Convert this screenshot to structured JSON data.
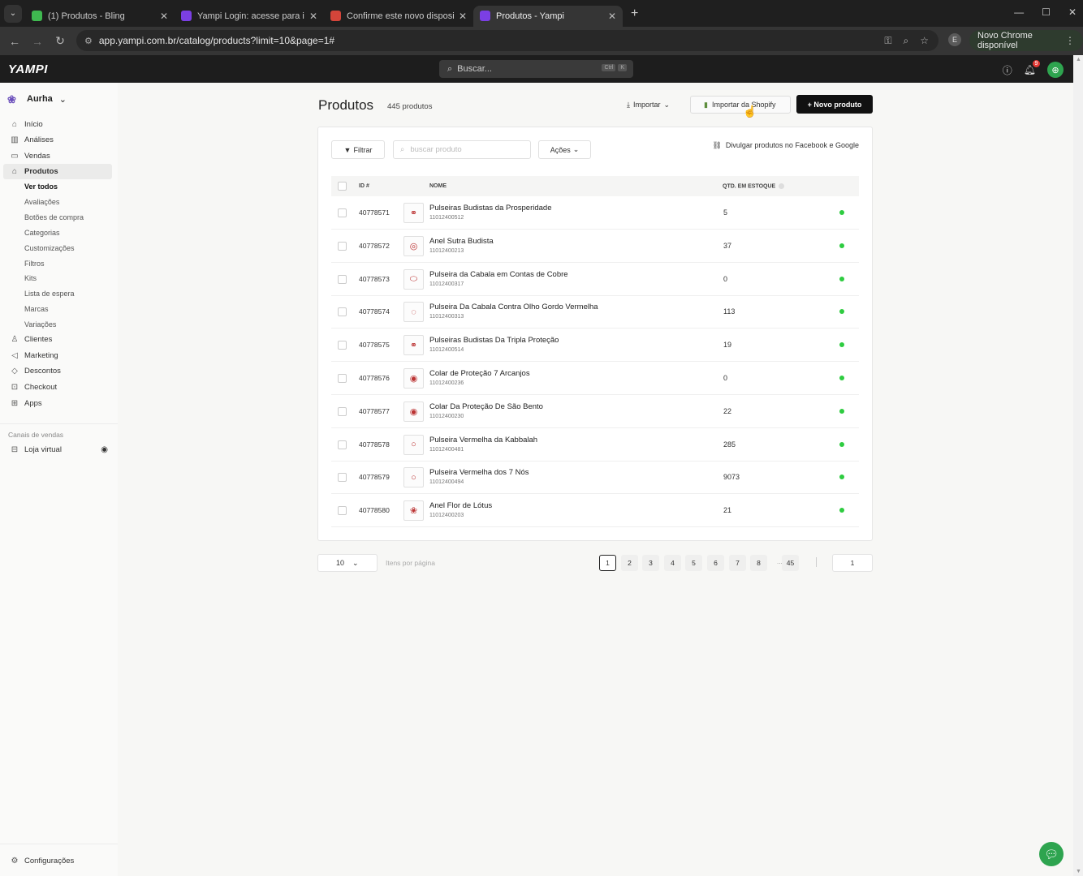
{
  "browser": {
    "tabs": [
      {
        "title": "(1) Produtos - Bling",
        "fav_color": "#3fb950",
        "fav_glyph": "B"
      },
      {
        "title": "Yampi Login: acesse para inicia",
        "fav_color": "#7b3fe4",
        "fav_glyph": "Y"
      },
      {
        "title": "Confirme este novo dispositivo",
        "fav_color": "#d4453a",
        "fav_glyph": "M"
      },
      {
        "title": "Produtos - Yampi",
        "fav_color": "#7b3fe4",
        "fav_glyph": "Y"
      }
    ],
    "url": "app.yampi.com.br/catalog/products?limit=10&page=1#",
    "profile_initial": "E",
    "update_label": "Novo Chrome disponível"
  },
  "app": {
    "logo": "YAMPI",
    "search_placeholder": "Buscar...",
    "kbd": [
      "Ctrl",
      "K"
    ],
    "notif_count": "9"
  },
  "sidebar": {
    "store_name": "Aurha",
    "items": [
      {
        "label": "Início",
        "icon": "home-icon"
      },
      {
        "label": "Análises",
        "icon": "chart-icon"
      },
      {
        "label": "Vendas",
        "icon": "inbox-icon"
      },
      {
        "label": "Produtos",
        "icon": "tag-icon"
      }
    ],
    "sub_items": [
      "Ver todos",
      "Avaliações",
      "Botões de compra",
      "Categorias",
      "Customizações",
      "Filtros",
      "Kits",
      "Lista de espera",
      "Marcas",
      "Variações"
    ],
    "items2": [
      {
        "label": "Clientes",
        "icon": "user-icon"
      },
      {
        "label": "Marketing",
        "icon": "megaphone-icon"
      },
      {
        "label": "Descontos",
        "icon": "discount-icon"
      },
      {
        "label": "Checkout",
        "icon": "cart-icon"
      },
      {
        "label": "Apps",
        "icon": "grid-icon"
      }
    ],
    "sales_channels_label": "Canais de vendas",
    "store_channel": "Loja virtual",
    "settings": "Configurações"
  },
  "main": {
    "title": "Produtos",
    "count": "445 produtos",
    "import_label": "Importar",
    "shopify_label": "Importar da Shopify",
    "new_label": "+ Novo produto",
    "filter_label": "Filtrar",
    "search_placeholder": "buscar produto",
    "actions_label": "Ações",
    "share_label": "Divulgar produtos no Facebook e Google",
    "columns": {
      "id": "ID #",
      "name": "NOME",
      "stock": "QTD. EM ESTOQUE"
    }
  },
  "products": [
    {
      "id": "40778571",
      "name": "Pulseiras Budistas da Prosperidade",
      "sku": "11012400512",
      "stock": "5",
      "thumb": "⚭"
    },
    {
      "id": "40778572",
      "name": "Anel Sutra Budista",
      "sku": "11012400213",
      "stock": "37",
      "thumb": "◎"
    },
    {
      "id": "40778573",
      "name": "Pulseira da Cabala em Contas de Cobre",
      "sku": "11012400317",
      "stock": "0",
      "thumb": "⬭"
    },
    {
      "id": "40778574",
      "name": "Pulseira Da Cabala Contra Olho Gordo Vermelha",
      "sku": "11012400313",
      "stock": "113",
      "thumb": "◌"
    },
    {
      "id": "40778575",
      "name": "Pulseiras Budistas Da Tripla Proteção",
      "sku": "11012400514",
      "stock": "19",
      "thumb": "⚭"
    },
    {
      "id": "40778576",
      "name": "Colar de Proteção 7 Arcanjos",
      "sku": "11012400236",
      "stock": "0",
      "thumb": "◉"
    },
    {
      "id": "40778577",
      "name": "Colar Da Proteção De São Bento",
      "sku": "11012400230",
      "stock": "22",
      "thumb": "◉"
    },
    {
      "id": "40778578",
      "name": "Pulseira Vermelha da Kabbalah",
      "sku": "11012400481",
      "stock": "285",
      "thumb": "○"
    },
    {
      "id": "40778579",
      "name": "Pulseira Vermelha dos 7 Nós",
      "sku": "11012400494",
      "stock": "9073",
      "thumb": "○"
    },
    {
      "id": "40778580",
      "name": "Anel Flor de Lótus",
      "sku": "11012400203",
      "stock": "21",
      "thumb": "❀"
    }
  ],
  "pagination": {
    "per_page": "10",
    "per_page_label": "Itens por página",
    "pages": [
      "1",
      "2",
      "3",
      "4",
      "5",
      "6",
      "7",
      "8"
    ],
    "dots": "...",
    "last": "45",
    "jump_value": "1"
  },
  "colors": {
    "status_active": "#2ecc40",
    "brand": "#111111",
    "chat": "#2ea44f"
  }
}
